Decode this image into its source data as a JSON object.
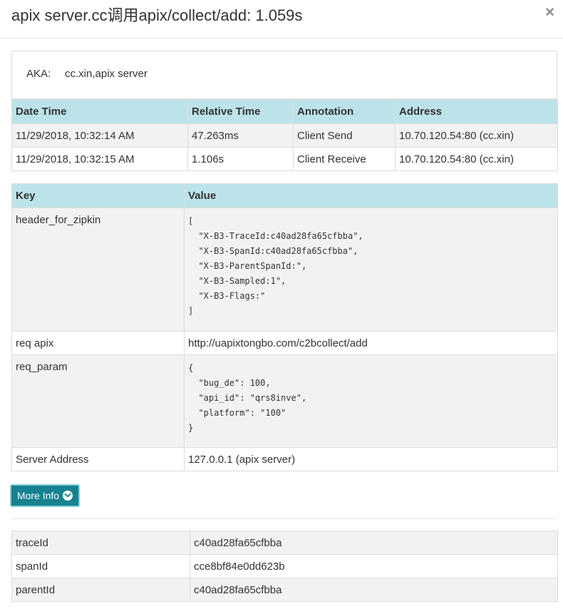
{
  "header": {
    "title": "apix server.cc调用apix/collect/add: 1.059s",
    "close_label": "×"
  },
  "aka": {
    "label": "AKA:",
    "value": "cc.xin,apix server"
  },
  "annotations": {
    "columns": [
      "Date Time",
      "Relative Time",
      "Annotation",
      "Address"
    ],
    "rows": [
      [
        "11/29/2018, 10:32:14 AM",
        "47.263ms",
        "Client Send",
        "10.70.120.54:80 (cc.xin)"
      ],
      [
        "11/29/2018, 10:32:15 AM",
        "1.106s",
        "Client Receive",
        "10.70.120.54:80 (cc.xin)"
      ]
    ]
  },
  "tags": {
    "columns": [
      "Key",
      "Value"
    ],
    "rows": [
      {
        "key": "header_for_zipkin",
        "value": "[\n  \"X-B3-TraceId:c40ad28fa65cfbba\",\n  \"X-B3-SpanId:c40ad28fa65cfbba\",\n  \"X-B3-ParentSpanId:\",\n  \"X-B3-Sampled:1\",\n  \"X-B3-Flags:\"\n]"
      },
      {
        "key": "req apix",
        "value": "http://uapixtongbo.com/c2bcollect/add"
      },
      {
        "key": "req_param",
        "value": "{\n  \"bug_de\": 100,\n  \"api_id\": \"qrs8inve\",\n  \"platform\": \"100\"\n}"
      },
      {
        "key": "Server Address",
        "value": "127.0.0.1 (apix server)"
      }
    ]
  },
  "more_info": {
    "label": "More Info"
  },
  "ids": {
    "rows": [
      [
        "traceId",
        "c40ad28fa65cfbba"
      ],
      [
        "spanId",
        "cce8bf84e0dd623b"
      ],
      [
        "parentId",
        "c40ad28fa65cfbba"
      ]
    ]
  }
}
